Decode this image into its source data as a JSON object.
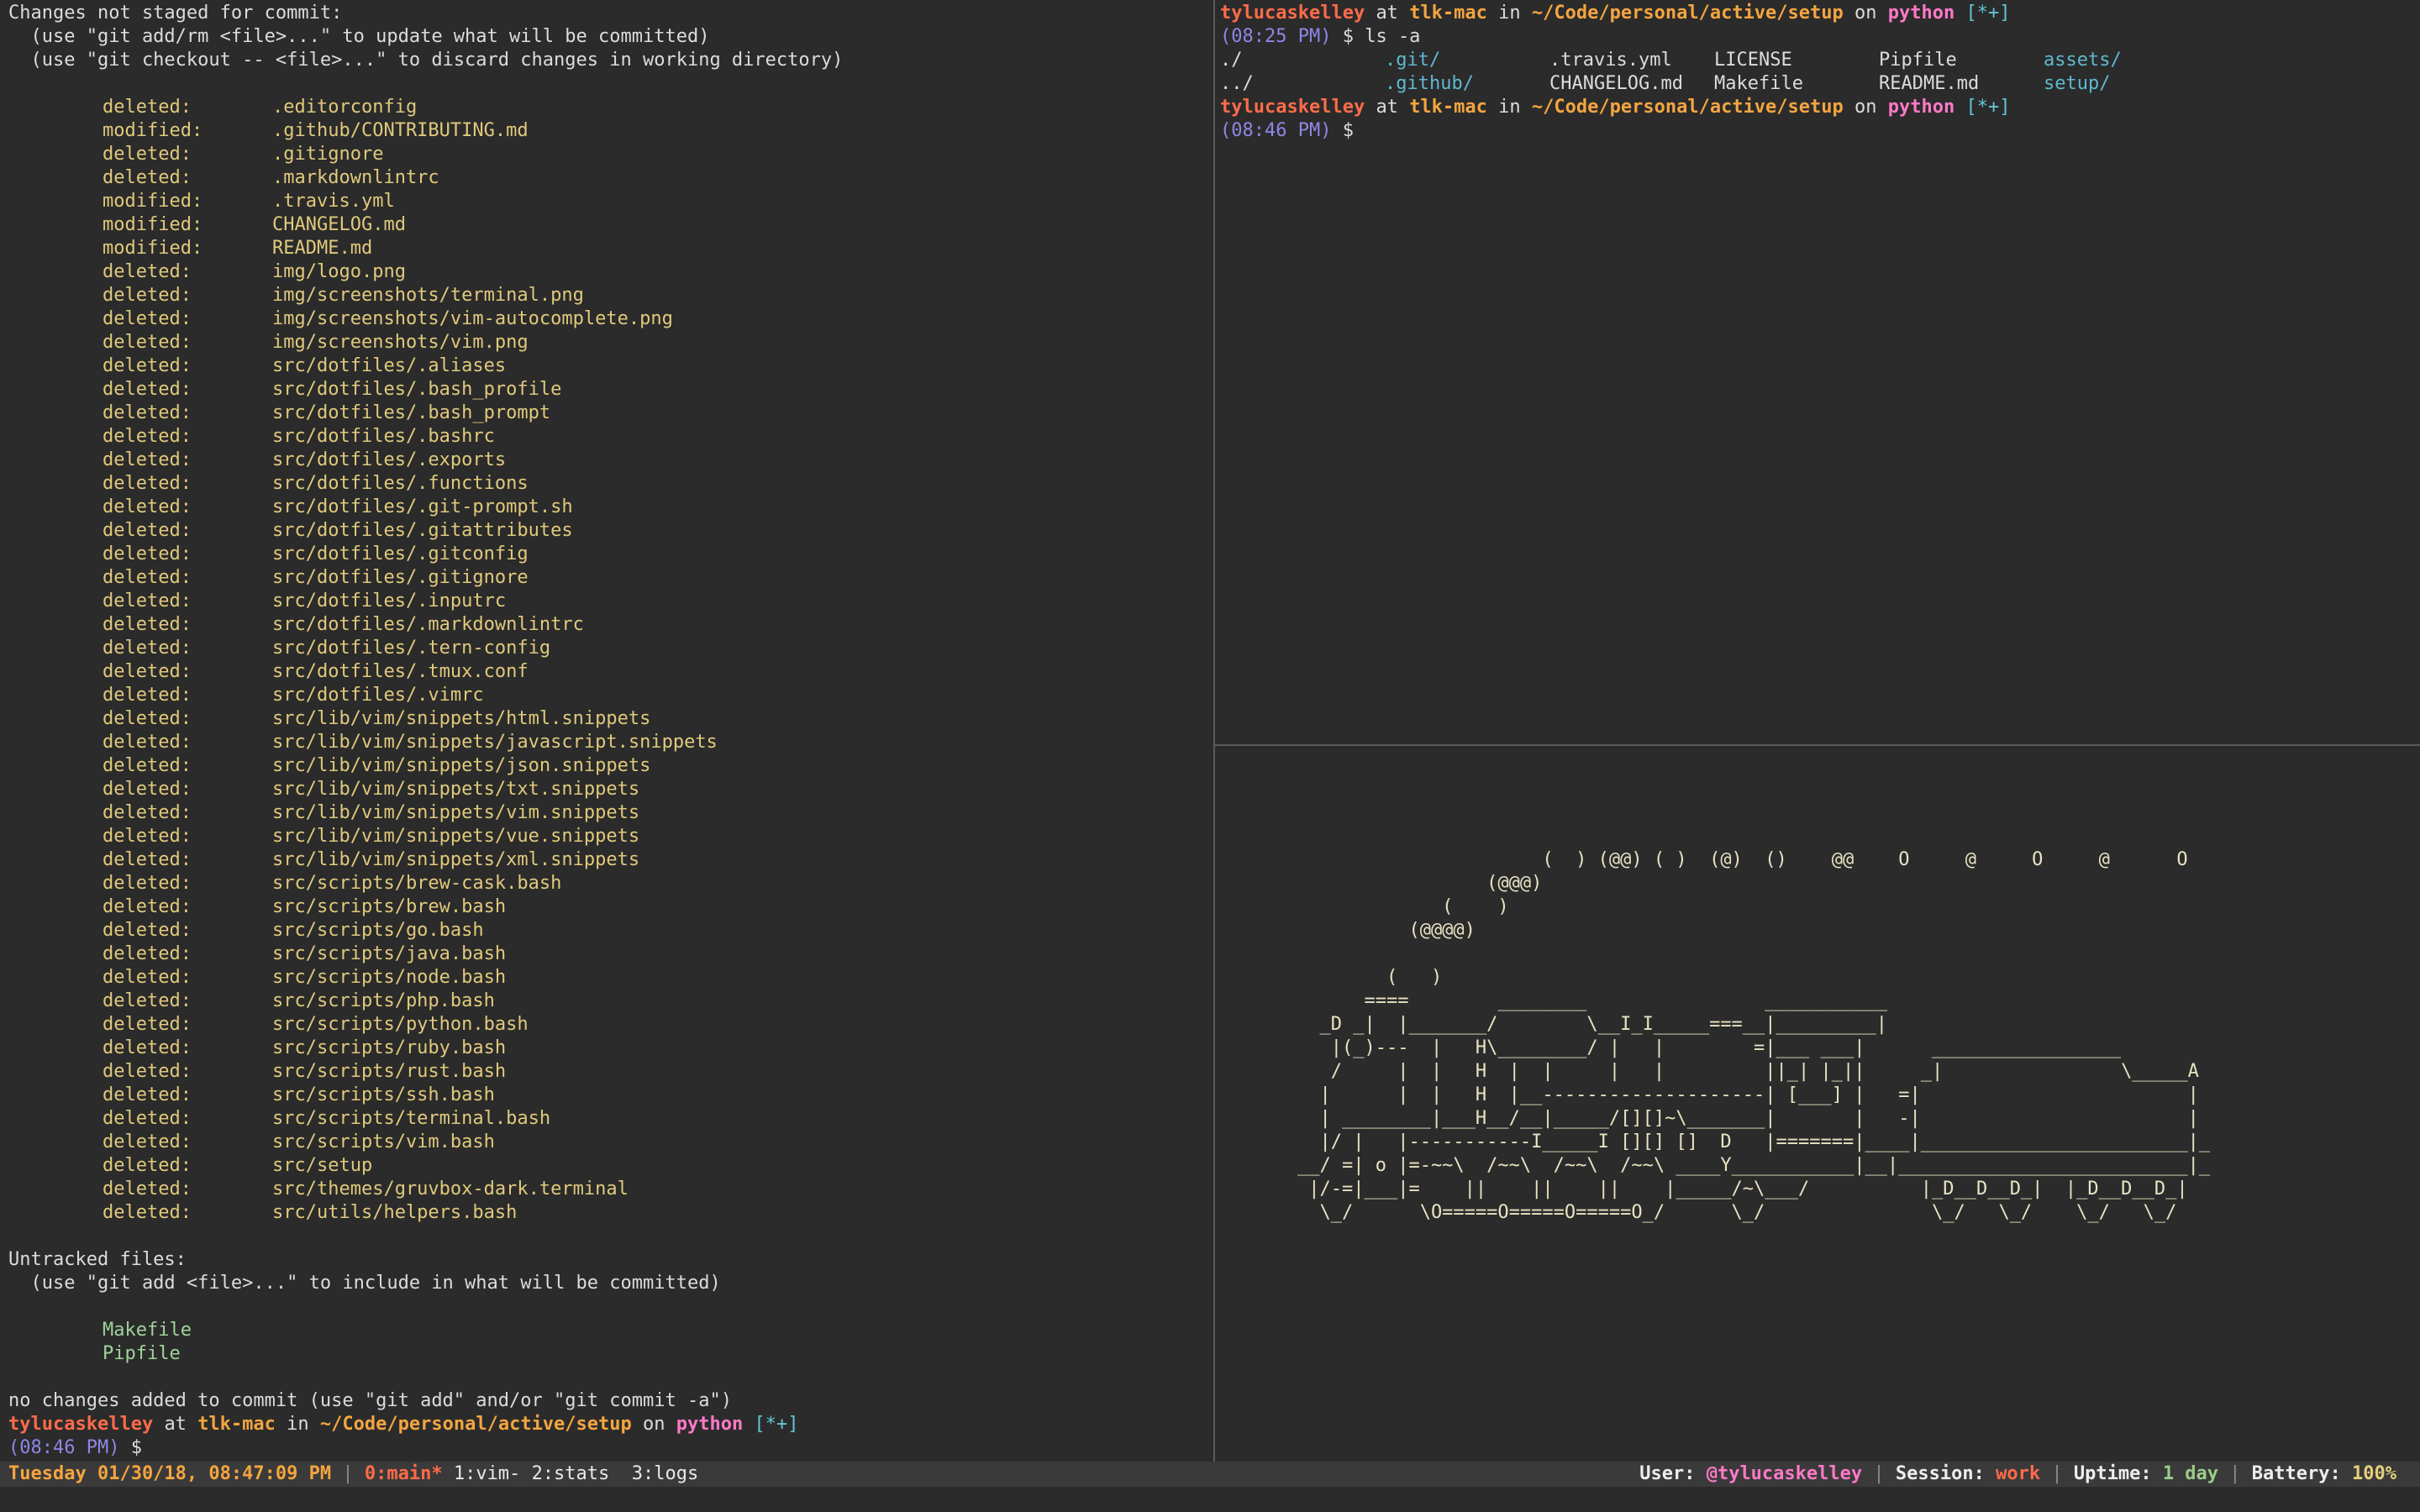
{
  "left_pane": {
    "header_lines": [
      "Changes not staged for commit:",
      "  (use \"git add/rm <file>...\" to update what will be committed)",
      "  (use \"git checkout -- <file>...\" to discard changes in working directory)"
    ],
    "changes": [
      {
        "status": "deleted:",
        "file": ".editorconfig"
      },
      {
        "status": "modified:",
        "file": ".github/CONTRIBUTING.md"
      },
      {
        "status": "deleted:",
        "file": ".gitignore"
      },
      {
        "status": "deleted:",
        "file": ".markdownlintrc"
      },
      {
        "status": "modified:",
        "file": ".travis.yml"
      },
      {
        "status": "modified:",
        "file": "CHANGELOG.md"
      },
      {
        "status": "modified:",
        "file": "README.md"
      },
      {
        "status": "deleted:",
        "file": "img/logo.png"
      },
      {
        "status": "deleted:",
        "file": "img/screenshots/terminal.png"
      },
      {
        "status": "deleted:",
        "file": "img/screenshots/vim-autocomplete.png"
      },
      {
        "status": "deleted:",
        "file": "img/screenshots/vim.png"
      },
      {
        "status": "deleted:",
        "file": "src/dotfiles/.aliases"
      },
      {
        "status": "deleted:",
        "file": "src/dotfiles/.bash_profile"
      },
      {
        "status": "deleted:",
        "file": "src/dotfiles/.bash_prompt"
      },
      {
        "status": "deleted:",
        "file": "src/dotfiles/.bashrc"
      },
      {
        "status": "deleted:",
        "file": "src/dotfiles/.exports"
      },
      {
        "status": "deleted:",
        "file": "src/dotfiles/.functions"
      },
      {
        "status": "deleted:",
        "file": "src/dotfiles/.git-prompt.sh"
      },
      {
        "status": "deleted:",
        "file": "src/dotfiles/.gitattributes"
      },
      {
        "status": "deleted:",
        "file": "src/dotfiles/.gitconfig"
      },
      {
        "status": "deleted:",
        "file": "src/dotfiles/.gitignore"
      },
      {
        "status": "deleted:",
        "file": "src/dotfiles/.inputrc"
      },
      {
        "status": "deleted:",
        "file": "src/dotfiles/.markdownlintrc"
      },
      {
        "status": "deleted:",
        "file": "src/dotfiles/.tern-config"
      },
      {
        "status": "deleted:",
        "file": "src/dotfiles/.tmux.conf"
      },
      {
        "status": "deleted:",
        "file": "src/dotfiles/.vimrc"
      },
      {
        "status": "deleted:",
        "file": "src/lib/vim/snippets/html.snippets"
      },
      {
        "status": "deleted:",
        "file": "src/lib/vim/snippets/javascript.snippets"
      },
      {
        "status": "deleted:",
        "file": "src/lib/vim/snippets/json.snippets"
      },
      {
        "status": "deleted:",
        "file": "src/lib/vim/snippets/txt.snippets"
      },
      {
        "status": "deleted:",
        "file": "src/lib/vim/snippets/vim.snippets"
      },
      {
        "status": "deleted:",
        "file": "src/lib/vim/snippets/vue.snippets"
      },
      {
        "status": "deleted:",
        "file": "src/lib/vim/snippets/xml.snippets"
      },
      {
        "status": "deleted:",
        "file": "src/scripts/brew-cask.bash"
      },
      {
        "status": "deleted:",
        "file": "src/scripts/brew.bash"
      },
      {
        "status": "deleted:",
        "file": "src/scripts/go.bash"
      },
      {
        "status": "deleted:",
        "file": "src/scripts/java.bash"
      },
      {
        "status": "deleted:",
        "file": "src/scripts/node.bash"
      },
      {
        "status": "deleted:",
        "file": "src/scripts/php.bash"
      },
      {
        "status": "deleted:",
        "file": "src/scripts/python.bash"
      },
      {
        "status": "deleted:",
        "file": "src/scripts/ruby.bash"
      },
      {
        "status": "deleted:",
        "file": "src/scripts/rust.bash"
      },
      {
        "status": "deleted:",
        "file": "src/scripts/ssh.bash"
      },
      {
        "status": "deleted:",
        "file": "src/scripts/terminal.bash"
      },
      {
        "status": "deleted:",
        "file": "src/scripts/vim.bash"
      },
      {
        "status": "deleted:",
        "file": "src/setup"
      },
      {
        "status": "deleted:",
        "file": "src/themes/gruvbox-dark.terminal"
      },
      {
        "status": "deleted:",
        "file": "src/utils/helpers.bash"
      }
    ],
    "untracked_header": "Untracked files:",
    "untracked_hint": "  (use \"git add <file>...\" to include in what will be committed)",
    "untracked": [
      "Makefile",
      "Pipfile"
    ],
    "footer": "no changes added to commit (use \"git add\" and/or \"git commit -a\")",
    "prompt": {
      "time": "(08:46 PM)"
    }
  },
  "prompt_common": {
    "user": "tylucaskelley",
    "at": "at",
    "host": "tlk-mac",
    "in": "in",
    "path": "~/Code/personal/active/setup",
    "on": "on",
    "branch": "python",
    "dirty": "[*+]",
    "symbol": "$"
  },
  "top_right": {
    "first_time": "(08:25 PM)",
    "command": "ls -a",
    "ls_rows": [
      [
        {
          "name": "./",
          "kind": "dir-plain"
        },
        {
          "name": ".git/",
          "kind": "dir"
        },
        {
          "name": ".travis.yml",
          "kind": "file"
        },
        {
          "name": "LICENSE",
          "kind": "file"
        },
        {
          "name": "Pipfile",
          "kind": "file"
        },
        {
          "name": "assets/",
          "kind": "dir"
        }
      ],
      [
        {
          "name": "../",
          "kind": "dir-plain"
        },
        {
          "name": ".github/",
          "kind": "dir"
        },
        {
          "name": "CHANGELOG.md",
          "kind": "file"
        },
        {
          "name": "Makefile",
          "kind": "file"
        },
        {
          "name": "README.md",
          "kind": "file"
        },
        {
          "name": "setup/",
          "kind": "dir"
        }
      ]
    ],
    "second_time": "(08:46 PM)"
  },
  "bottom_right": {
    "train_art": "                      (  ) (@@) ( )  (@)  ()    @@    O     @     O     @      O\n                 (@@@)\n             (    )\n          (@@@@)\n\n        (   )\n      ====        ________                ___________\n  _D _|  |_______/        \\__I_I_____===__|_________|\n   |(_)---  |   H\\________/ |   |        =|___ ___|      _________________\n   /     |  |   H  |  |     |   |         ||_| |_||     _|                \\_____A\n  |      |  |   H  |__--------------------| [___] |   =|                        |\n  | ________|___H__/__|_____/[][]~\\_______|       |   -|                        |\n  |/ |   |-----------I_____I [][] []  D   |=======|____|________________________|_\n__/ =| o |=-~~\\  /~~\\  /~~\\  /~~\\ ____Y___________|__|__________________________|_\n |/-=|___|=    ||    ||    ||    |_____/~\\___/          |_D__D__D_|  |_D__D__D_|\n  \\_/      \\O=====O=====O=====O_/      \\_/               \\_/   \\_/    \\_/   \\_/"
  },
  "statusbar": {
    "datetime": "Tuesday 01/30/18, 08:47:09 PM",
    "sep": "|",
    "active_window": "0:main*",
    "windows": [
      "1:vim-",
      "2:stats",
      "3:logs"
    ],
    "user_label": "User:",
    "user_value": "@tylucaskelley",
    "session_label": "Session:",
    "session_value": "work",
    "uptime_label": "Uptime:",
    "uptime_value": "1 day",
    "battery_label": "Battery:",
    "battery_value": "100%"
  },
  "colors": {
    "background": "#2b2b2b",
    "user": "#ff6b4a",
    "host": "#f4a540",
    "branch": "#ff79c6",
    "dirty": "#61c7d6",
    "time": "#8f86e6",
    "modified_file": "#e0c97c",
    "untracked_file": "#9fd39a"
  }
}
